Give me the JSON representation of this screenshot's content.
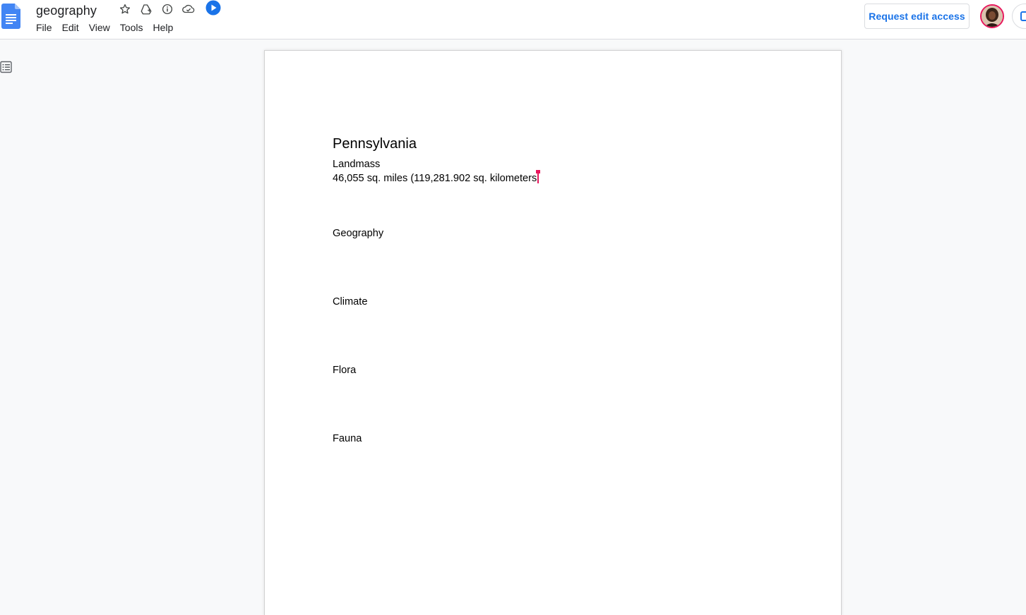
{
  "header": {
    "title": "geography",
    "menu": [
      "File",
      "Edit",
      "View",
      "Tools",
      "Help"
    ],
    "request_edit_label": "Request edit access",
    "accent_color": "#1a73e8",
    "logo_color": "#4285f4",
    "collaborator_color": "#e8175d"
  },
  "document": {
    "heading": "Pennsylvania",
    "landmass_label": "Landmass",
    "landmass_value": "46,055 sq. miles (119,281.902 sq. kilometers",
    "sections": [
      "Geography",
      "Climate",
      "Flora",
      "Fauna"
    ]
  }
}
